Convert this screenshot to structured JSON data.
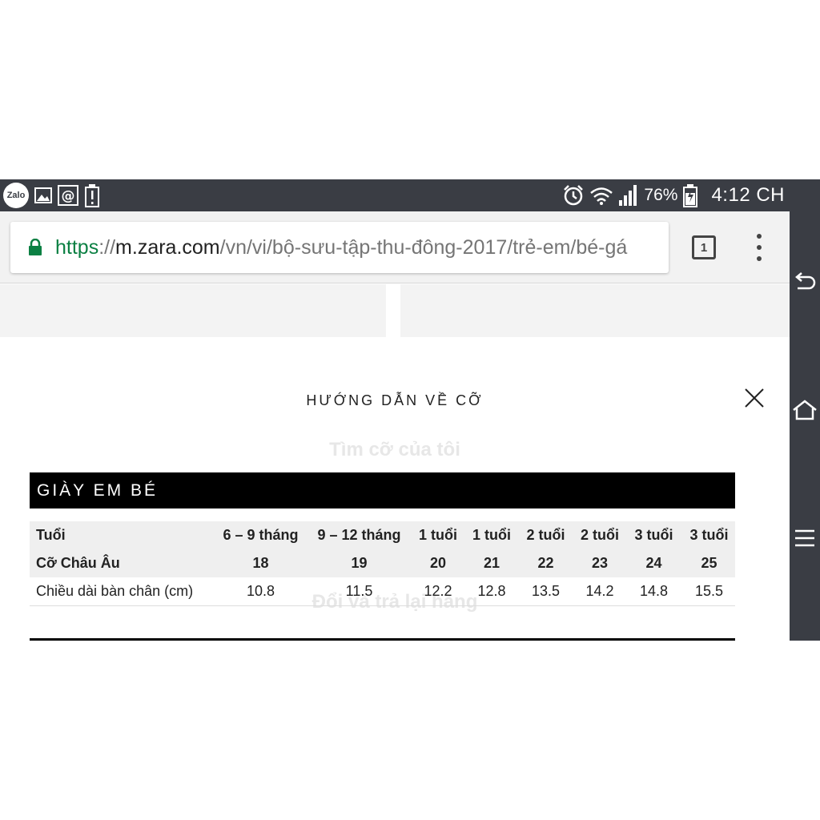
{
  "status_bar": {
    "zalo_label": "Zalo",
    "battery_percent": "76%",
    "time": "4:12 CH"
  },
  "browser": {
    "url_scheme": "https",
    "url_separator": "://",
    "url_host": "m.zara.com",
    "url_path": "/vn/vi/bộ-sưu-tập-thu-đông-2017/trẻ-em/bé-gá",
    "tab_count": "1"
  },
  "background_ghost_text": {
    "find_size": "Tìm cỡ của tôi",
    "returns": "Đổi và trả lại hàng"
  },
  "modal": {
    "title": "HƯỚNG DẪN VỀ CỠ",
    "section_header": "GIÀY EM BÉ",
    "table": {
      "rows": [
        {
          "label": "Tuổi",
          "cells": [
            "6 – 9 tháng",
            "9 – 12 tháng",
            "1 tuổi",
            "1 tuổi",
            "2 tuổi",
            "2 tuổi",
            "3 tuổi",
            "3 tuổi"
          ]
        },
        {
          "label": "Cỡ Châu Âu",
          "cells": [
            "18",
            "19",
            "20",
            "21",
            "22",
            "23",
            "24",
            "25"
          ]
        },
        {
          "label": "Chiều dài bàn chân (cm)",
          "cells": [
            "10.8",
            "11.5",
            "12.2",
            "12.8",
            "13.5",
            "14.2",
            "14.8",
            "15.5"
          ]
        }
      ]
    }
  },
  "icons": {
    "status_left": [
      "zalo-icon",
      "image-icon",
      "at-sign-icon",
      "battery-alert-icon"
    ],
    "status_right": [
      "alarm-icon",
      "wifi-icon",
      "signal-icon",
      "battery-charging-icon"
    ],
    "nav": [
      "back-icon",
      "home-icon",
      "menu-icon"
    ],
    "browser": [
      "lock-icon",
      "tab-switcher-icon",
      "overflow-menu-icon"
    ],
    "modal": [
      "close-icon"
    ]
  },
  "colors": {
    "status_bar": "#3a3d44",
    "secure_scheme": "#0b8043",
    "header_bar": "#000000",
    "table_shade": "#efefef"
  }
}
